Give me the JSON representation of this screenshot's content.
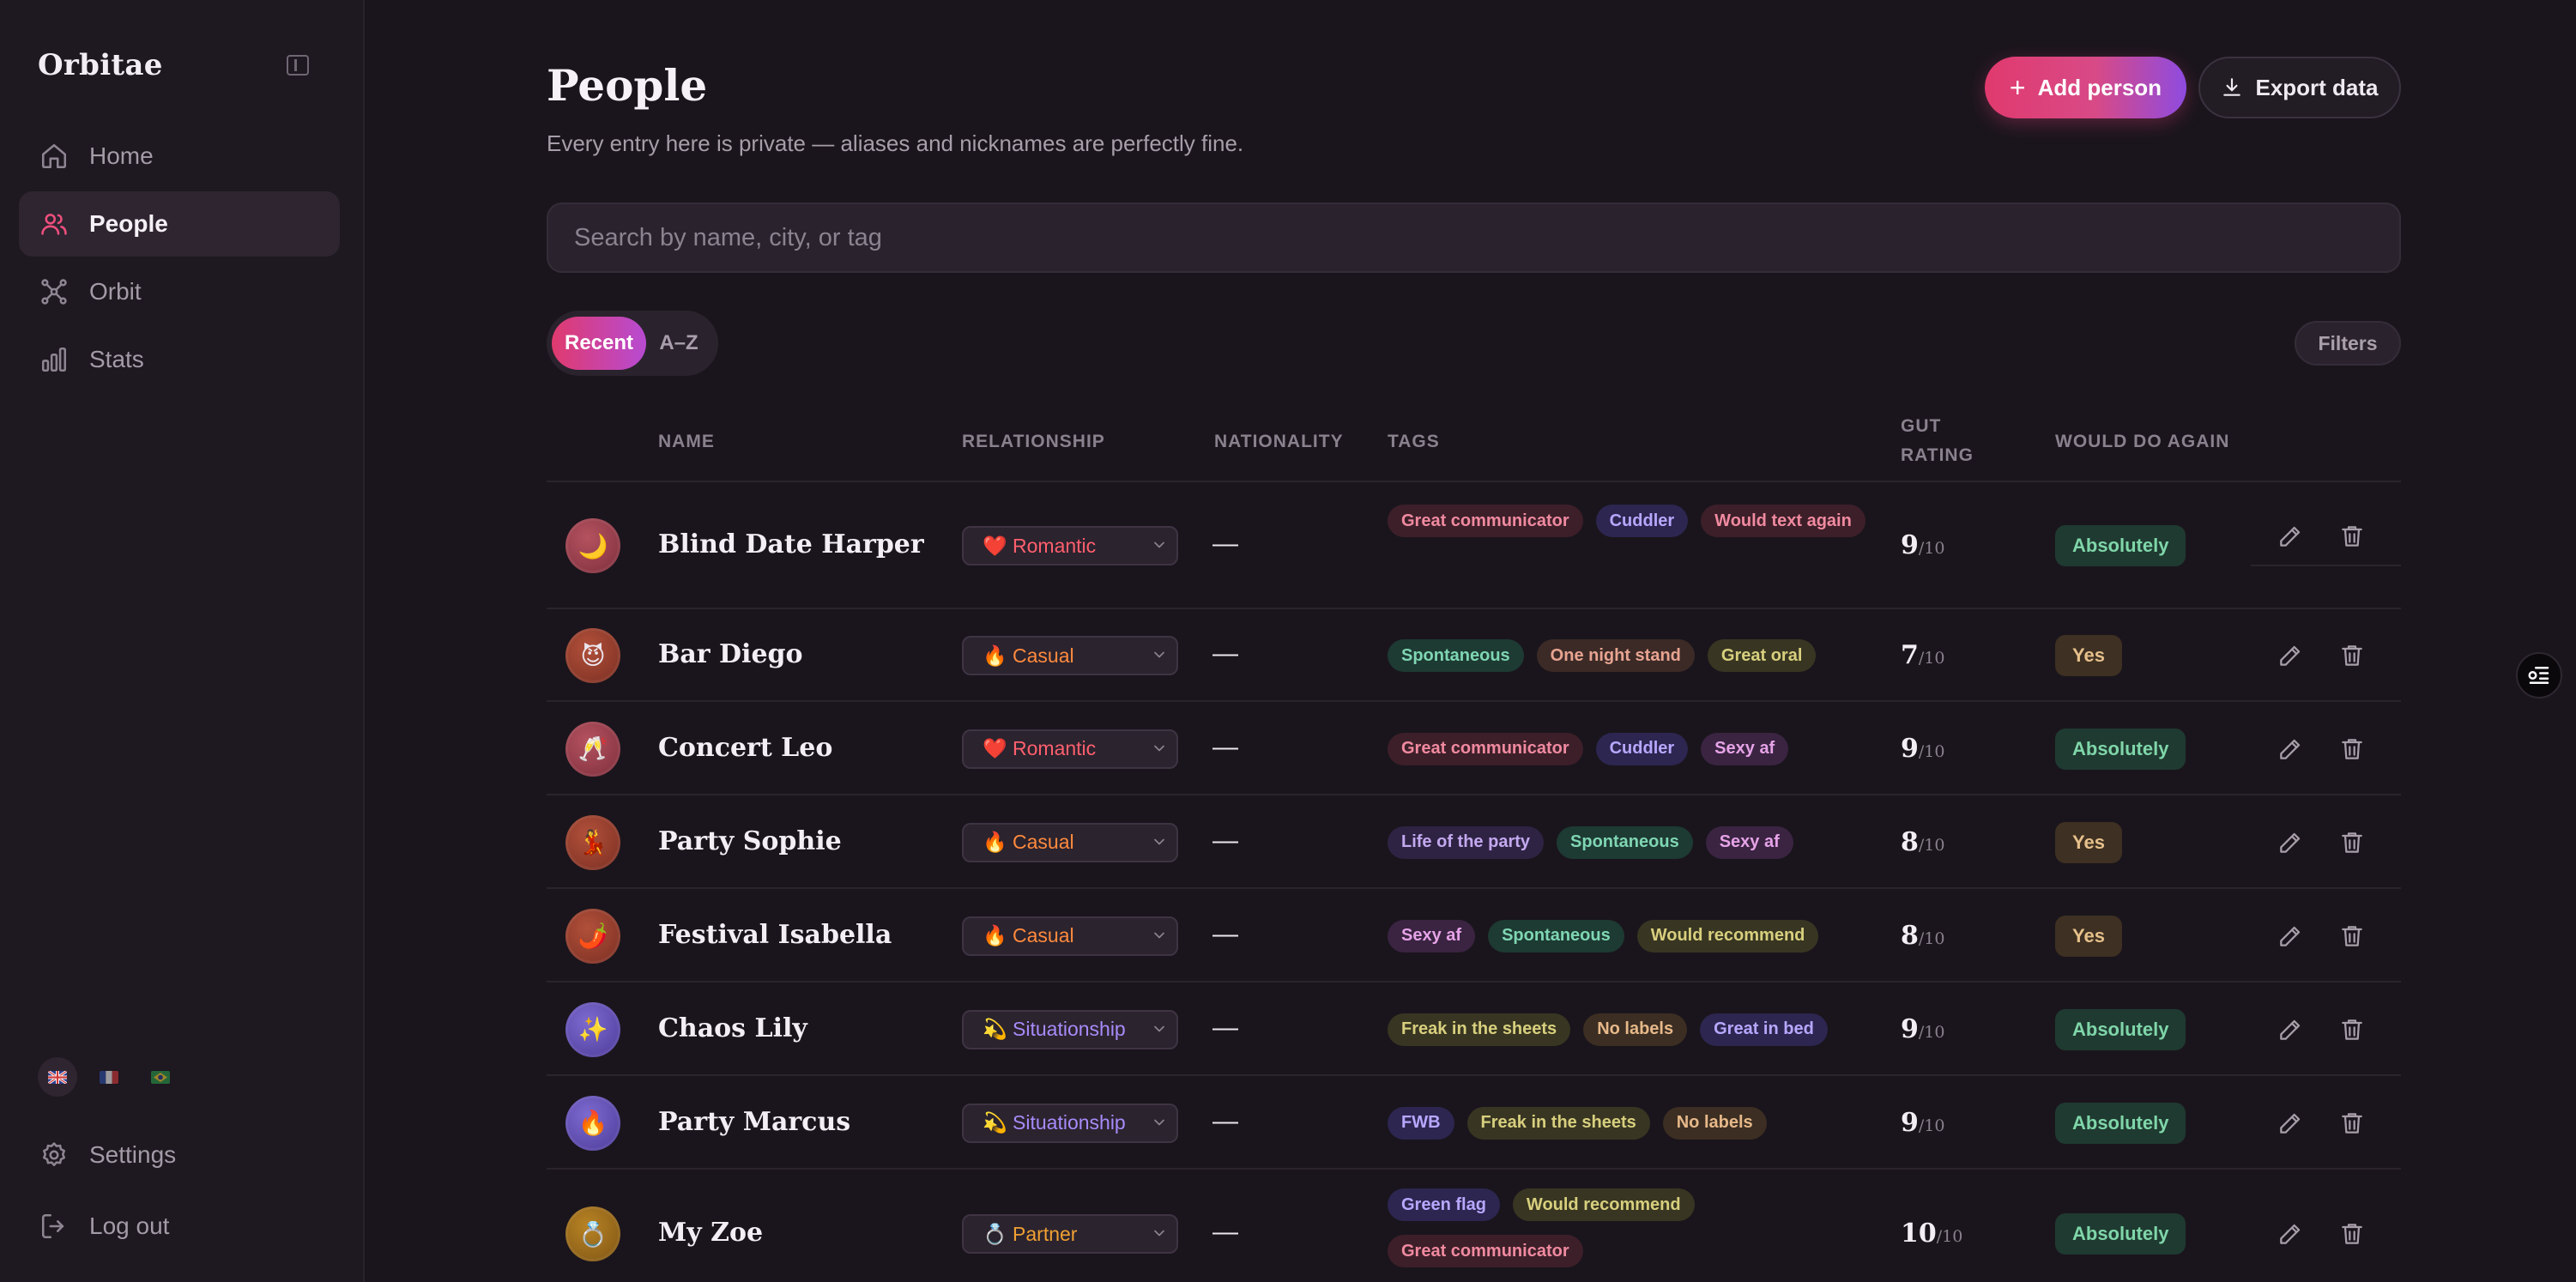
{
  "sidebar": {
    "brand": "Orbitae",
    "nav": [
      {
        "label": "Home",
        "icon": "home-icon"
      },
      {
        "label": "People",
        "icon": "people-icon",
        "active": true
      },
      {
        "label": "Orbit",
        "icon": "orbit-icon"
      },
      {
        "label": "Stats",
        "icon": "stats-icon"
      }
    ],
    "languages": [
      "en",
      "fr",
      "br"
    ],
    "settings_label": "Settings",
    "logout_label": "Log out"
  },
  "header": {
    "title": "People",
    "subtitle": "Every entry here is private — aliases and nicknames are perfectly fine.",
    "add_label": "Add person",
    "export_label": "Export data"
  },
  "search": {
    "placeholder": "Search by name, city, or tag"
  },
  "sort": {
    "options": [
      "Recent",
      "A–Z"
    ],
    "active": "Recent"
  },
  "filters_label": "Filters",
  "table": {
    "columns": {
      "name": "NAME",
      "relationship": "RELATIONSHIP",
      "nationality": "NATIONALITY",
      "tags": "TAGS",
      "gut_rating": "GUT RATING",
      "would_do_again": "WOULD DO AGAIN"
    },
    "rows": [
      {
        "avatar": "🌙",
        "name": "Blind Date Harper",
        "relationship": "❤️ Romantic",
        "nationality": "—",
        "tags": [
          "Great communicator",
          "Cuddler",
          "Would text again"
        ],
        "gut": "9",
        "gut_max": "/10",
        "again": "Absolutely"
      },
      {
        "avatar": "😈",
        "name": "Bar Diego",
        "relationship": "🔥 Casual",
        "nationality": "—",
        "tags": [
          "Spontaneous",
          "One night stand",
          "Great oral"
        ],
        "gut": "7",
        "gut_max": "/10",
        "again": "Yes"
      },
      {
        "avatar": "🥂",
        "name": "Concert Leo",
        "relationship": "❤️ Romantic",
        "nationality": "—",
        "tags": [
          "Great communicator",
          "Cuddler",
          "Sexy af"
        ],
        "gut": "9",
        "gut_max": "/10",
        "again": "Absolutely"
      },
      {
        "avatar": "💃",
        "name": "Party Sophie",
        "relationship": "🔥 Casual",
        "nationality": "—",
        "tags": [
          "Life of the party",
          "Spontaneous",
          "Sexy af"
        ],
        "gut": "8",
        "gut_max": "/10",
        "again": "Yes"
      },
      {
        "avatar": "🌶️",
        "name": "Festival Isabella",
        "relationship": "🔥 Casual",
        "nationality": "—",
        "tags": [
          "Sexy af",
          "Spontaneous",
          "Would recommend"
        ],
        "gut": "8",
        "gut_max": "/10",
        "again": "Yes"
      },
      {
        "avatar": "✨",
        "name": "Chaos Lily",
        "relationship": "💫 Situationship",
        "nationality": "—",
        "tags": [
          "Freak in the sheets",
          "No labels",
          "Great in bed"
        ],
        "gut": "9",
        "gut_max": "/10",
        "again": "Absolutely"
      },
      {
        "avatar": "🔥",
        "name": "Party Marcus",
        "relationship": "💫 Situationship",
        "nationality": "—",
        "tags": [
          "FWB",
          "Freak in the sheets",
          "No labels"
        ],
        "gut": "9",
        "gut_max": "/10",
        "again": "Absolutely"
      },
      {
        "avatar": "💍",
        "name": "My Zoe",
        "relationship": "💍 Partner",
        "nationality": "—",
        "tags": [
          "Green flag",
          "Would recommend",
          "Great communicator"
        ],
        "gut": "10",
        "gut_max": "/10",
        "again": "Absolutely"
      }
    ]
  },
  "colors": {
    "accent_pink": "#e03a6e",
    "accent_purple": "#8e4be0",
    "romantic": "#ff5f6d",
    "casual": "#ff8a3d",
    "situationship": "#a78bfa",
    "partner": "#f0a032"
  }
}
